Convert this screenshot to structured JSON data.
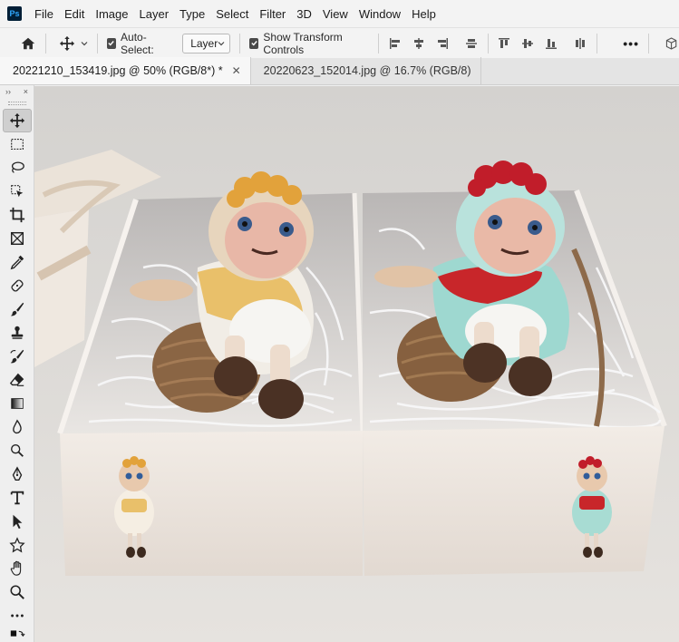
{
  "app": {
    "logo_text": "Ps"
  },
  "menu": [
    "File",
    "Edit",
    "Image",
    "Layer",
    "Type",
    "Select",
    "Filter",
    "3D",
    "View",
    "Window",
    "Help"
  ],
  "options": {
    "auto_select_label": "Auto-Select:",
    "auto_select_target": "Layer",
    "show_transform_label": "Show Transform Controls",
    "more_label": "•••"
  },
  "tabs": [
    {
      "label": "20221210_153419.jpg @ 50% (RGB/8*) *",
      "active": true
    },
    {
      "label": "20220623_152014.jpg @ 16.7% (RGB/8)",
      "active": false
    }
  ],
  "toolbar": {
    "collapse_label": "››",
    "close_label": "×",
    "tools": [
      "move",
      "marquee",
      "lasso",
      "object-select",
      "crop",
      "frame",
      "eyedropper",
      "healing",
      "brush",
      "stamp",
      "history-brush",
      "eraser",
      "gradient",
      "blur",
      "dodge",
      "pen",
      "type",
      "path-select",
      "shape",
      "hand",
      "zoom",
      "more"
    ]
  },
  "colors": {
    "menu_bg": "#f3f3f3",
    "tab_active_bg": "#f7f7f7",
    "toolbar_bg": "#efefef",
    "ps_brand": "#31a8ff"
  }
}
